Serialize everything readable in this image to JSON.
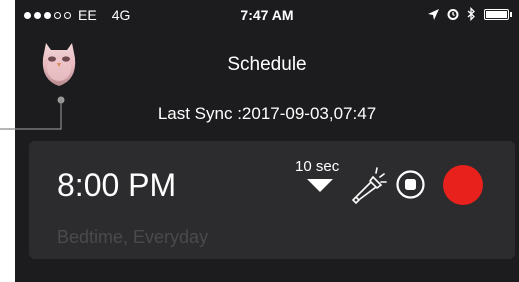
{
  "status_bar": {
    "carrier": "EE",
    "network": "4G",
    "time": "7:47 AM",
    "signal_bars_filled": 3,
    "signal_bars_total": 5
  },
  "header": {
    "title": "Schedule"
  },
  "sync": {
    "label": "Last Sync :2017-09-03,07:47"
  },
  "schedule_item": {
    "time": "8:00 PM",
    "description": "Bedtime, Everyday",
    "duration": "10 sec",
    "record_color": "#e8211c"
  },
  "icons": [
    "location-arrow-icon",
    "alarm-icon",
    "bluetooth-icon",
    "battery-icon",
    "owl-avatar-icon",
    "chevron-down-icon",
    "flashlight-icon",
    "stop-icon",
    "record-icon"
  ]
}
